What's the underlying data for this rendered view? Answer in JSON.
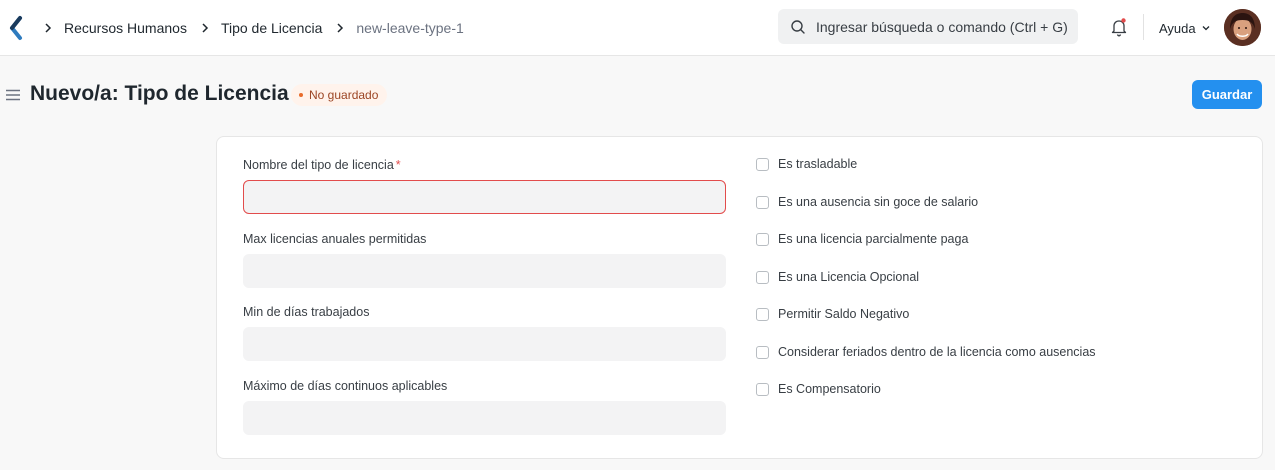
{
  "breadcrumbs": [
    "Recursos Humanos",
    "Tipo de Licencia",
    "new-leave-type-1"
  ],
  "search": {
    "placeholder": "Ingresar búsqueda o comando (Ctrl + G)"
  },
  "header": {
    "help_label": "Ayuda"
  },
  "page": {
    "title": "Nuevo/a: Tipo de Licencia",
    "status": "No guardado",
    "save_label": "Guardar"
  },
  "form": {
    "fields": [
      {
        "label": "Nombre del tipo de licencia",
        "required_mark": "*",
        "value": ""
      },
      {
        "label": "Max licencias anuales permitidas",
        "value": ""
      },
      {
        "label": "Min de días trabajados",
        "value": ""
      },
      {
        "label": "Máximo de días continuos aplicables",
        "value": ""
      }
    ],
    "checkboxes": [
      {
        "label": "Es trasladable",
        "checked": false
      },
      {
        "label": "Es una ausencia sin goce de salario",
        "checked": false
      },
      {
        "label": "Es una licencia parcialmente paga",
        "checked": false
      },
      {
        "label": "Es una Licencia Opcional",
        "checked": false
      },
      {
        "label": "Permitir Saldo Negativo",
        "checked": false
      },
      {
        "label": "Considerar feriados dentro de la licencia como ausencias",
        "checked": false
      },
      {
        "label": "Es Compensatorio",
        "checked": false
      }
    ]
  },
  "colors": {
    "primary": "#2490ef",
    "error": "#e24c4c",
    "status_text": "#9c4524",
    "status_bg": "#fff3ec"
  },
  "icons": {
    "logo": "frappe-logo-icon",
    "search": "search-icon",
    "notifications": "bell-icon",
    "help": "chevron-down-icon",
    "menu": "hamburger-icon"
  }
}
